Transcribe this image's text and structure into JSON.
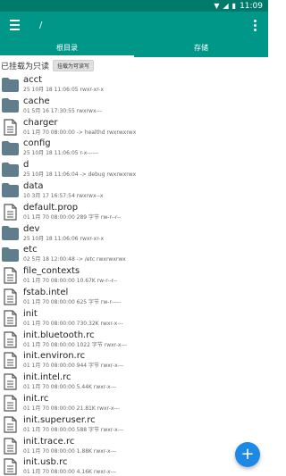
{
  "status": {
    "time": "11:09"
  },
  "appbar": {
    "path": "/"
  },
  "tabs": [
    {
      "label": "根目录",
      "active": true
    },
    {
      "label": "存储",
      "active": false
    }
  ],
  "info": {
    "label": "已挂载为只读",
    "button": "挂载为可读写"
  },
  "files": [
    {
      "name": "acct",
      "meta": "25 10月 18 11:06:05   rwxr-xr-x",
      "type": "folder"
    },
    {
      "name": "cache",
      "meta": "01 5月 16 17:30:55   rwxrwx---",
      "type": "folder"
    },
    {
      "name": "charger",
      "meta": "01 1月 70 08:00:00 -> healthd  rwxrwxrwx",
      "type": "file"
    },
    {
      "name": "config",
      "meta": "25 10月 18 11:06:05   r-x------",
      "type": "folder"
    },
    {
      "name": "d",
      "meta": "25 10月 18 11:06:04 -> debug  rwxrwxrwx",
      "type": "folder"
    },
    {
      "name": "data",
      "meta": "10 3月 17 16:57:54   rwxrwx--x",
      "type": "folder"
    },
    {
      "name": "default.prop",
      "meta": "01 1月 70 08:00:00  289 字节  rw-r--r--",
      "type": "file"
    },
    {
      "name": "dev",
      "meta": "25 10月 18 11:06:06   rwxr-xr-x",
      "type": "folder"
    },
    {
      "name": "etc",
      "meta": "02 5月 18 12:00:48 -> /etc  rwxrwxrwx",
      "type": "folder"
    },
    {
      "name": "file_contexts",
      "meta": "01 1月 70 08:00:00  10.67K  rw-r--r--",
      "type": "file"
    },
    {
      "name": "fstab.intel",
      "meta": "01 1月 70 08:00:00  625 字节  rw-r-----",
      "type": "file"
    },
    {
      "name": "init",
      "meta": "01 1月 70 08:00:00  730.32K  rwxr-x---",
      "type": "file"
    },
    {
      "name": "init.bluetooth.rc",
      "meta": "01 1月 70 08:00:00  1022 字节  rwxr-x---",
      "type": "file"
    },
    {
      "name": "init.environ.rc",
      "meta": "01 1月 70 08:00:00  944 字节  rwxr-x---",
      "type": "file"
    },
    {
      "name": "init.intel.rc",
      "meta": "01 1月 70 08:00:00  5.44K  rwxr-x---",
      "type": "file"
    },
    {
      "name": "init.rc",
      "meta": "01 1月 70 08:00:00  21.81K  rwxr-x---",
      "type": "file"
    },
    {
      "name": "init.superuser.rc",
      "meta": "01 1月 70 08:00:00  588 字节  rwxr-x---",
      "type": "file"
    },
    {
      "name": "init.trace.rc",
      "meta": "01 1月 70 08:00:00  1.88K  rwxr-x---",
      "type": "file"
    },
    {
      "name": "init.usb.rc",
      "meta": "01 1月 70 08:00:00  4.16K  rwxr-x---",
      "type": "file"
    }
  ],
  "fab": {
    "label": "+"
  },
  "colors": {
    "primary": "#009688",
    "statusbar": "#007a6b",
    "fab": "#1e88e5",
    "folder": "#607d8b"
  }
}
